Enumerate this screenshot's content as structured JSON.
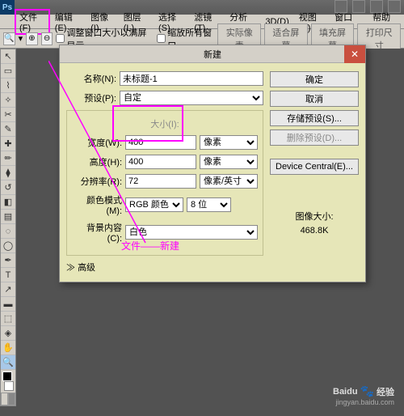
{
  "menubar": {
    "file": "文件(F)",
    "items": [
      "编辑(E)",
      "图像(I)",
      "图层(L)",
      "选择(S)",
      "滤镜(T)",
      "分析(A)",
      "3D(D)",
      "视图(V)",
      "窗口(W)",
      "帮助(H)"
    ]
  },
  "options": {
    "check1": "调整窗口大小以满屏显示",
    "check2": "缩放所有窗口",
    "btns": [
      "实际像素",
      "适合屏幕",
      "填充屏幕",
      "打印尺寸"
    ]
  },
  "dialog": {
    "title": "新建",
    "name_label": "名称(N):",
    "name_value": "未标题-1",
    "preset_label": "预设(P):",
    "preset_value": "自定",
    "size_label": "大小(I):",
    "width_label": "宽度(W):",
    "width_value": "400",
    "width_unit": "像素",
    "height_label": "高度(H):",
    "height_value": "400",
    "height_unit": "像素",
    "res_label": "分辨率(R):",
    "res_value": "72",
    "res_unit": "像素/英寸",
    "mode_label": "颜色模式(M):",
    "mode_value": "RGB 颜色",
    "depth_value": "8 位",
    "bg_label": "背景内容(C):",
    "bg_value": "白色",
    "advanced": "高级",
    "ok": "确定",
    "cancel": "取消",
    "save_preset": "存储预设(S)...",
    "del_preset": "删除预设(D)...",
    "device": "Device Central(E)...",
    "img_size_label": "图像大小:",
    "img_size_value": "468.8K"
  },
  "annotation": "文件——新建",
  "watermark": {
    "main": "Baidu",
    "sub": "jingyan.baidu.com",
    "brand": "经验"
  }
}
